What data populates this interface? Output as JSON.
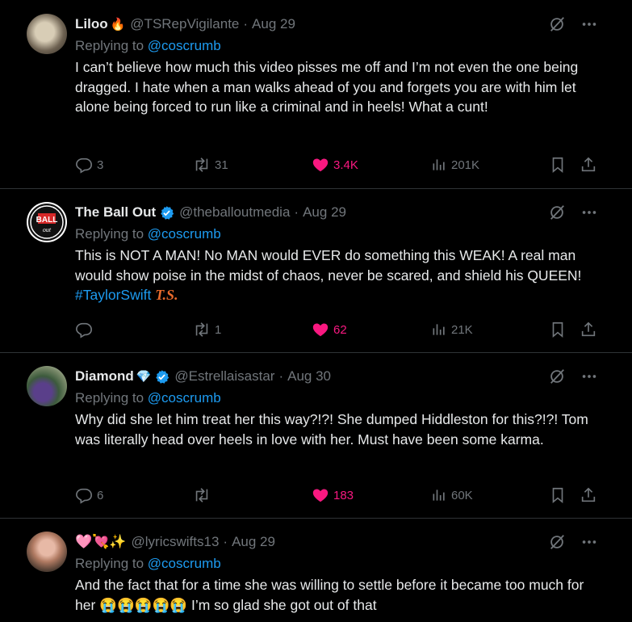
{
  "tweets": [
    {
      "name": "Liloo",
      "name_emoji": "🔥",
      "verified": false,
      "handle": "@TSRepVigilante",
      "dot": "·",
      "date": "Aug 29",
      "replying_prefix": "Replying to",
      "replying_handle": "@coscrumb",
      "text": "I can’t believe how much this video pisses me off and I’m not even the one being dragged. I hate when a man walks ahead of you and forgets you are with him let alone being forced to run like a criminal and in heels! What a cunt!",
      "replies": "3",
      "retweets": "31",
      "likes": "3.4K",
      "views": "201K"
    },
    {
      "name": "The Ball Out",
      "verified": true,
      "handle": "@theballoutmedia",
      "dot": "·",
      "date": "Aug 29",
      "replying_prefix": "Replying to",
      "replying_handle": "@coscrumb",
      "text": "This is NOT A MAN! No MAN would EVER do something this WEAK! A real man would show poise in the midst of chaos, never be scared, and shield his QUEEN! ",
      "hashtag": "#TaylorSwift",
      "hashtag_emoji": "T.S.",
      "replies": "",
      "retweets": "1",
      "likes": "62",
      "views": "21K"
    },
    {
      "name": "Diamond",
      "name_emoji": "💎",
      "verified": true,
      "handle": "@Estrellaisastar",
      "dot": "·",
      "date": "Aug 30",
      "replying_prefix": "Replying to",
      "replying_handle": "@coscrumb",
      "text": "Why did she let him treat her this way?!?! She dumped Hiddleston for this?!?! Tom was literally head over heels in love with her. Must have been some karma.",
      "replies": "6",
      "retweets": "",
      "likes": "183",
      "views": "60K"
    },
    {
      "name": "🩷💘✨",
      "verified": false,
      "handle": "@lyricswifts13",
      "dot": "·",
      "date": "Aug 29",
      "replying_prefix": "Replying to",
      "replying_handle": "@coscrumb",
      "text": "And the fact that for a time she was willing to settle before it became too much for her 😭😭😭😭😭 I’m so glad she got out of that"
    }
  ],
  "colors": {
    "background": "#000000",
    "text": "#e7e9ea",
    "muted": "#71767b",
    "link": "#1d9bf0",
    "like": "#f91880",
    "divider": "#2f3336",
    "verified": "#1d9bf0"
  },
  "icons": [
    "grok-icon",
    "more-icon",
    "reply-icon",
    "retweet-icon",
    "heart-icon",
    "views-icon",
    "bookmark-icon",
    "share-icon",
    "verified-badge-icon"
  ]
}
